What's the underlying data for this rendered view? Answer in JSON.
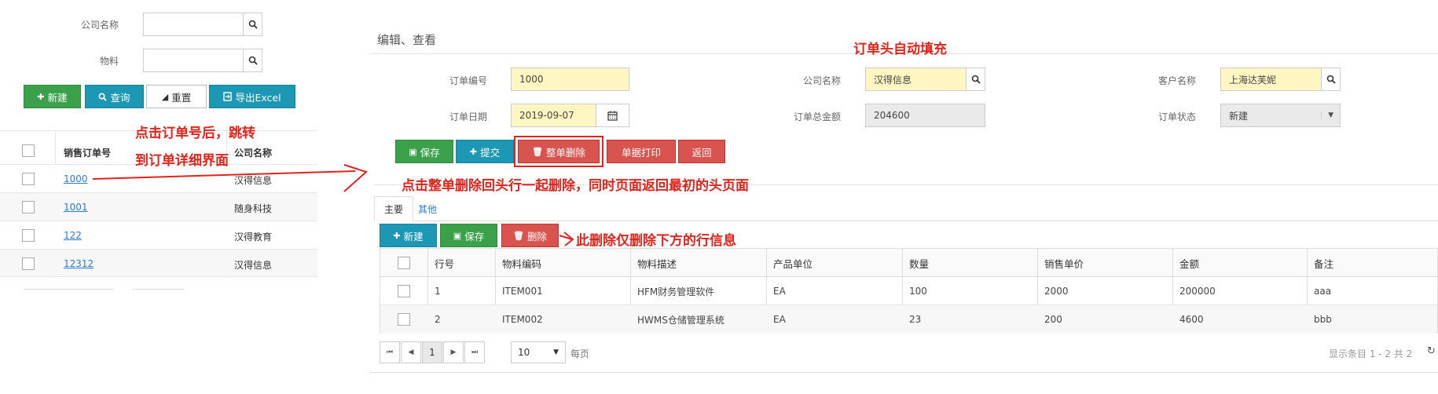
{
  "list_page": {
    "filters": {
      "company_label": "公司名称",
      "company_value": "",
      "material_label": "物料",
      "material_value": ""
    },
    "buttons": {
      "new": "新建",
      "query": "查询",
      "reset": "重置",
      "export": "导出Excel"
    },
    "table": {
      "headers": [
        "销售订单号",
        "公司名称"
      ],
      "rows": [
        {
          "order": "1000",
          "company": "汉得信息"
        },
        {
          "order": "1001",
          "company": "随身科技"
        },
        {
          "order": "122",
          "company": "汉得教育"
        },
        {
          "order": "12312",
          "company": "汉得信息"
        }
      ]
    }
  },
  "detail_page": {
    "title": "编辑、查看",
    "header": {
      "order_no_label": "订单编号",
      "order_no_value": "1000",
      "company_label": "公司名称",
      "company_value": "汉得信息",
      "customer_label": "客户名称",
      "customer_value": "上海达芙妮",
      "order_date_label": "订单日期",
      "order_date_value": "2019-09-07",
      "total_label": "订单总金额",
      "total_value": "204600",
      "status_label": "订单状态",
      "status_value": "新建"
    },
    "buttons": {
      "save": "保存",
      "submit": "提交",
      "delete_all": "整单删除",
      "print": "单据打印",
      "back": "返回"
    },
    "tabs": [
      "主要",
      "其他"
    ],
    "line_buttons": {
      "new": "新建",
      "save": "保存",
      "delete": "删除"
    },
    "lines_table": {
      "headers": [
        "行号",
        "物料编码",
        "物料描述",
        "产品单位",
        "数量",
        "销售单价",
        "金额",
        "备注"
      ],
      "rows": [
        [
          "1",
          "ITEM001",
          "HFM财务管理软件",
          "EA",
          "100",
          "2000",
          "200000",
          "aaa"
        ],
        [
          "2",
          "ITEM002",
          "HWMS仓储管理系统",
          "EA",
          "23",
          "200",
          "4600",
          "bbb"
        ]
      ]
    },
    "pager": {
      "current_page": "1",
      "page_size": "10",
      "per_page_label": "每页",
      "summary": "显示条目 1 - 2 共 2"
    }
  },
  "annotations": {
    "click_order": "点击订单号后，跳转",
    "click_order_2": "到订单详细界面",
    "header_autofill": "订单头自动填充",
    "delete_all_note": "点击整单删除回头行一起删除，同时页面返回最初的头页面",
    "delete_line_note": "此删除仅删除下方的行信息"
  },
  "colors": {
    "green": "#3aa14a",
    "blue": "#1c97b4",
    "red": "#d9534f",
    "annotation_red": "#e0241b",
    "required_yellow": "#fff6c2"
  }
}
